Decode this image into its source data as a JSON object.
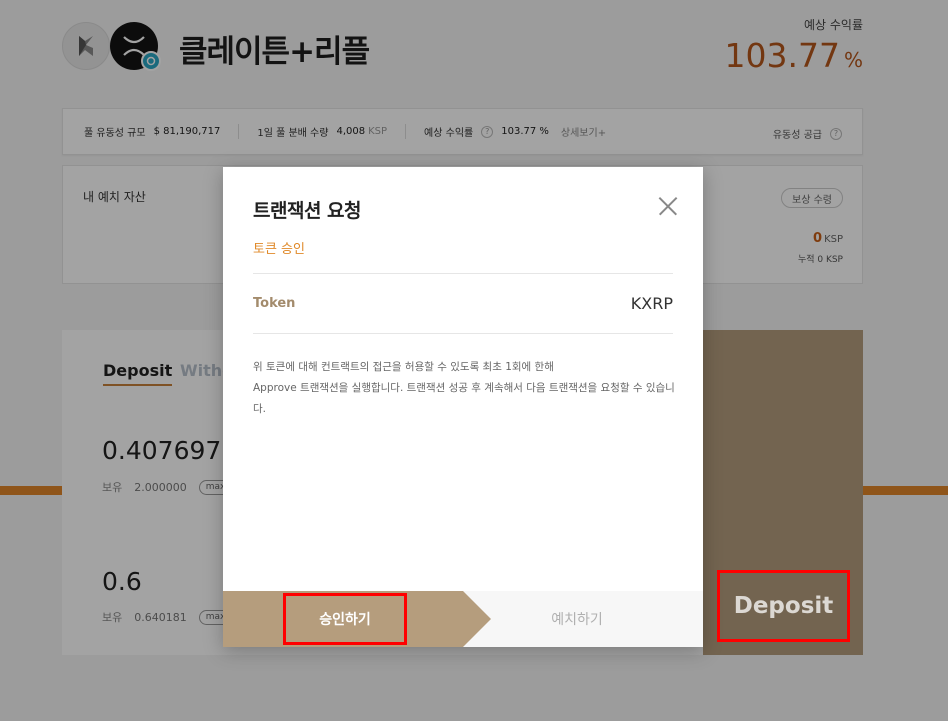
{
  "header": {
    "pool_title": "클레이튼+리플",
    "apr_label": "예상 수익률",
    "apr_value": "103.77",
    "apr_unit": "%",
    "logos": [
      "klay-icon",
      "xrp-icon"
    ]
  },
  "stats": {
    "liquidity_label": "풀 유동성 규모",
    "liquidity_value": "$  81,190,717",
    "daily_label": "1일 풀 분배 수량",
    "daily_value": "4,008",
    "daily_unit": "KSP",
    "apr_label": "예상 수익률",
    "apr_value": "103.77 %",
    "detail_link": "상세보기+",
    "supply_label": "유동성 공급",
    "help_glyph": "?"
  },
  "assets": {
    "title": "내 예치 자산",
    "claim_button": "보상 수령",
    "reward_value": "0",
    "reward_unit": "KSP",
    "reward_cumulative": "누적 0 KSP"
  },
  "deposit": {
    "tab_deposit": "Deposit",
    "tab_withdraw": "Withdraw",
    "token1_amount": "0.407697",
    "token1_balance_label": "보유",
    "token1_balance": "2.000000",
    "token2_amount": "0.6",
    "token2_balance_label": "보유",
    "token2_balance": "0.640181",
    "max_label": "max",
    "deposit_button": "Deposit"
  },
  "modal": {
    "title": "트랜잭션 요청",
    "step_label": "토큰 승인",
    "token_key": "Token",
    "token_value": "KXRP",
    "notice_line1": "위 토큰에 대해 컨트랙트의 접근을 허용할 수 있도록 최초 1회에 한해",
    "notice_line2": "Approve 트랜잭션을 실행합니다. 트랜잭션 성공 후 계속해서 다음 트랜잭션을 요청할 수 있습니다.",
    "approve_button": "승인하기",
    "deposit_step_button": "예치하기"
  },
  "colors": {
    "accent_orange": "#e0852a",
    "brand_tan": "#b59d7d",
    "apr_red": "#b5561c",
    "highlight_red": "#ff0000"
  }
}
